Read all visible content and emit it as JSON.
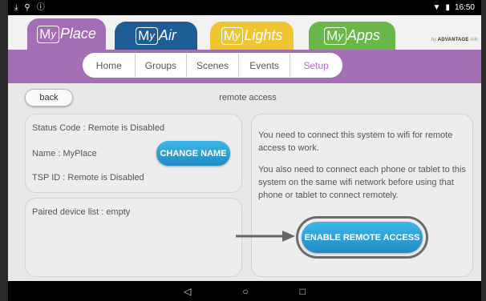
{
  "statusbar": {
    "left_icons": [
      "download-icon",
      "usb-icon",
      "info-icon"
    ],
    "time": "16:50"
  },
  "header": {
    "tabs": [
      {
        "box_cap": "M",
        "box_small": "y",
        "rest": "Place"
      },
      {
        "box_cap": "M",
        "box_small": "y",
        "rest": "Air"
      },
      {
        "box_cap": "M",
        "box_small": "y",
        "rest": "Lights"
      },
      {
        "box_cap": "M",
        "box_small": "y",
        "rest": "Apps"
      }
    ],
    "brand_by": "by",
    "brand_name": "ADVANTAGE",
    "brand_suffix": "AIR"
  },
  "subnav": {
    "items": [
      "Home",
      "Groups",
      "Scenes",
      "Events",
      "Setup"
    ],
    "active": "Setup"
  },
  "page": {
    "back_label": "back",
    "title": "remote access"
  },
  "status_panel": {
    "status_code": "Status Code : Remote is Disabled",
    "name": "Name : MyPlace",
    "tsp_id": "TSP ID : Remote is Disabled",
    "change_name_label": "CHANGE NAME"
  },
  "paired_panel": {
    "text": "Paired device list : empty"
  },
  "info_panel": {
    "para1": "You need to connect this system to wifi for remote access to work.",
    "para2": "You also need to connect each phone or tablet to this system on the same wifi network before using that phone or tablet to connect remotely.",
    "enable_label": "ENABLE REMOTE ACCESS"
  },
  "navbar": {
    "icons": [
      "back-icon",
      "home-icon",
      "recents-icon"
    ]
  },
  "colors": {
    "myplace": "#a56db5",
    "myair": "#1e5c95",
    "mylights": "#f0c531",
    "myapps": "#6ab84a",
    "button_blue": "#2aa0d8",
    "subnav_purple": "#a66fb5"
  }
}
